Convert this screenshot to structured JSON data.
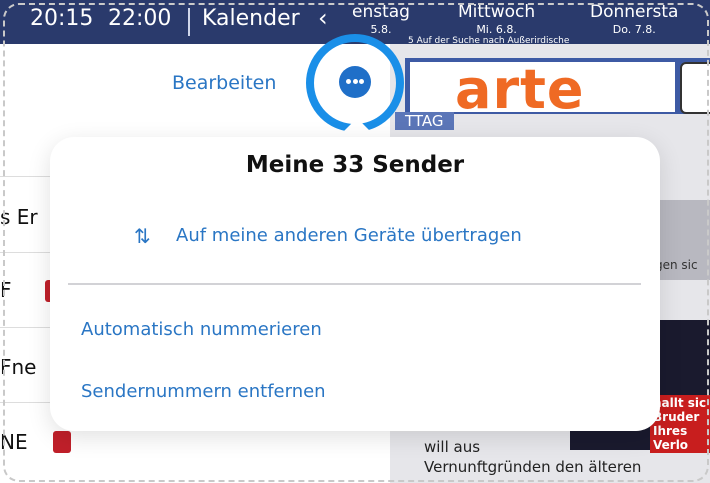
{
  "topbar": {
    "time_start": "20:15",
    "time_end": "22:00",
    "calendar_label": "Kalender",
    "back_icon": "chevron-left-icon",
    "days": [
      {
        "name": "enstag",
        "date": "5.8."
      },
      {
        "name": "Mittwoch",
        "date": "Mi. 6.8."
      },
      {
        "name": "Donnersta",
        "date": "Do. 7.8."
      }
    ],
    "subtitle": "5 Auf der Suche nach Außerirdische"
  },
  "background": {
    "channel_logo": "arte",
    "section_tag": "TTAG",
    "promo_text": "gen sic",
    "promo_banner_line1": "nallt sic",
    "promo_banner_line2": "Bruder Ihres Verlo",
    "body_line1": "will aus",
    "body_line2": "Vernunftgründen den älteren",
    "left_rows": [
      "s Er",
      "F",
      "Fne",
      "NE"
    ]
  },
  "header": {
    "edit_label": "Bearbeiten",
    "more_icon": "ellipsis-icon",
    "accent_color": "#1f6fc8",
    "highlight_color": "#1a8fe8"
  },
  "popover": {
    "title": "Meine 33 Sender",
    "transfer_icon": "arrows-up-down-icon",
    "transfer_label": "Auf meine anderen Geräte übertragen",
    "items": [
      "Automatisch nummerieren",
      "Sendernummern entfernen"
    ]
  }
}
